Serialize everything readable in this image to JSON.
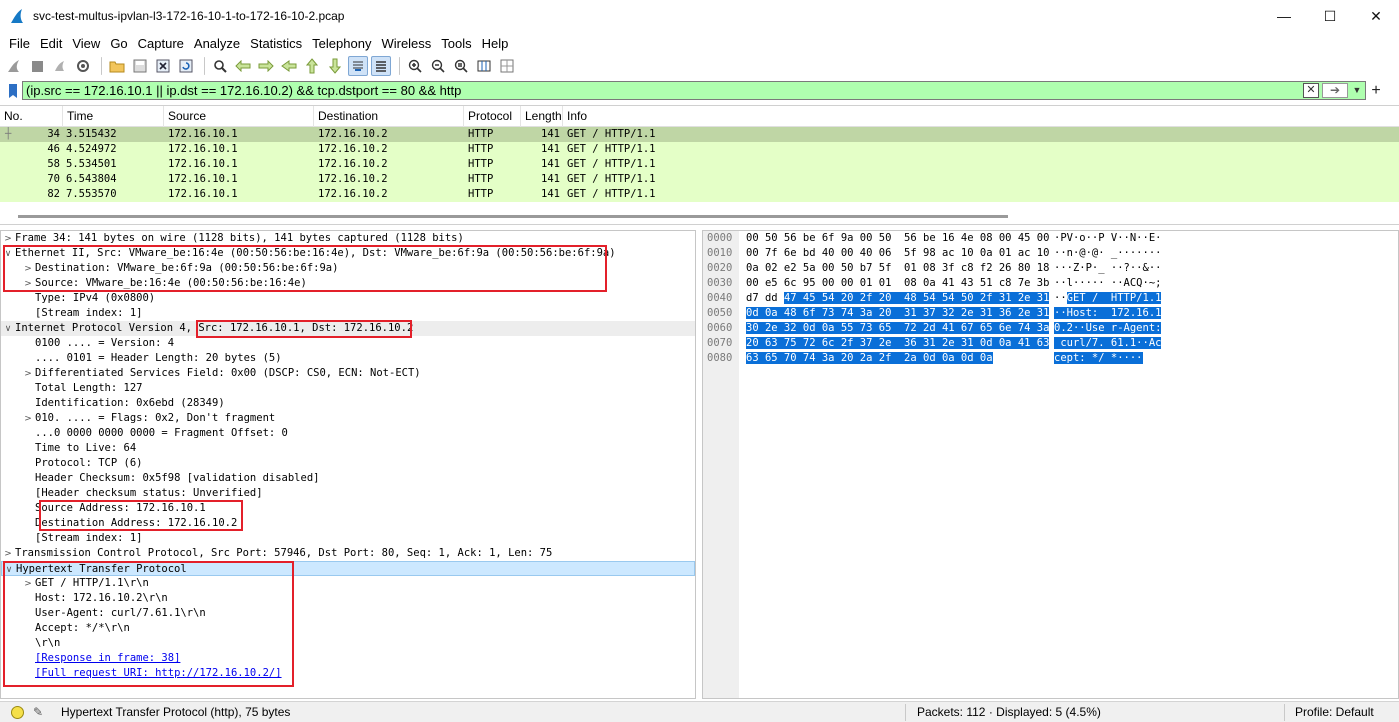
{
  "window": {
    "title": "svc-test-multus-ipvlan-l3-172-16-10-1-to-172-16-10-2.pcap",
    "minimize": "—",
    "maximize": "☐",
    "close": "✕"
  },
  "menu": [
    "File",
    "Edit",
    "View",
    "Go",
    "Capture",
    "Analyze",
    "Statistics",
    "Telephony",
    "Wireless",
    "Tools",
    "Help"
  ],
  "filter": {
    "value": "(ip.src == 172.16.10.1 || ip.dst == 172.16.10.2) && tcp.dstport == 80 && http",
    "bg_color": "#afffaf"
  },
  "packet_list": {
    "columns": [
      "No.",
      "Time",
      "Source",
      "Destination",
      "Protocol",
      "Length",
      "Info"
    ],
    "rows": [
      {
        "no": "34",
        "time": "3.515432",
        "src": "172.16.10.1",
        "dst": "172.16.10.2",
        "proto": "HTTP",
        "len": "141",
        "info": "GET / HTTP/1.1"
      },
      {
        "no": "46",
        "time": "4.524972",
        "src": "172.16.10.1",
        "dst": "172.16.10.2",
        "proto": "HTTP",
        "len": "141",
        "info": "GET / HTTP/1.1"
      },
      {
        "no": "58",
        "time": "5.534501",
        "src": "172.16.10.1",
        "dst": "172.16.10.2",
        "proto": "HTTP",
        "len": "141",
        "info": "GET / HTTP/1.1"
      },
      {
        "no": "70",
        "time": "6.543804",
        "src": "172.16.10.1",
        "dst": "172.16.10.2",
        "proto": "HTTP",
        "len": "141",
        "info": "GET / HTTP/1.1"
      },
      {
        "no": "82",
        "time": "7.553570",
        "src": "172.16.10.1",
        "dst": "172.16.10.2",
        "proto": "HTTP",
        "len": "141",
        "info": "GET / HTTP/1.1"
      }
    ],
    "row_color": "#e4ffc7",
    "selected_color": "#bfd6a5"
  },
  "details": {
    "frame": "Frame 34: 141 bytes on wire (1128 bits), 141 bytes captured (1128 bits)",
    "eth": "Ethernet II, Src: VMware_be:16:4e (00:50:56:be:16:4e), Dst: VMware_be:6f:9a (00:50:56:be:6f:9a)",
    "eth_dst": "Destination: VMware_be:6f:9a (00:50:56:be:6f:9a)",
    "eth_src": "Source: VMware_be:16:4e (00:50:56:be:16:4e)",
    "eth_type": "Type: IPv4 (0x0800)",
    "eth_stream": "[Stream index: 1]",
    "ip_prefix": "Internet Protocol Version 4,",
    "ip_addrs": "Src: 172.16.10.1, Dst: 172.16.10.2",
    "ip_version": "0100 .... = Version: 4",
    "ip_hlen": ".... 0101 = Header Length: 20 bytes (5)",
    "ip_dsf": "Differentiated Services Field: 0x00 (DSCP: CS0, ECN: Not-ECT)",
    "ip_totlen": "Total Length: 127",
    "ip_id": "Identification: 0x6ebd (28349)",
    "ip_flags": "010. .... = Flags: 0x2, Don't fragment",
    "ip_frag": "...0 0000 0000 0000 = Fragment Offset: 0",
    "ip_ttl": "Time to Live: 64",
    "ip_proto": "Protocol: TCP (6)",
    "ip_cksum": "Header Checksum: 0x5f98 [validation disabled]",
    "ip_cksum_status": "[Header checksum status: Unverified]",
    "ip_src": "Source Address: 172.16.10.1",
    "ip_dst": "Destination Address: 172.16.10.2",
    "ip_stream": "[Stream index: 1]",
    "tcp": "Transmission Control Protocol, Src Port: 57946, Dst Port: 80, Seq: 1, Ack: 1, Len: 75",
    "http": "Hypertext Transfer Protocol",
    "http_get": "GET / HTTP/1.1\\r\\n",
    "http_host": "Host: 172.16.10.2\\r\\n",
    "http_ua": "User-Agent: curl/7.61.1\\r\\n",
    "http_accept": "Accept: */*\\r\\n",
    "http_crlf": "\\r\\n",
    "http_response": "[Response in frame: 38]",
    "http_uri": "[Full request URI: http://172.16.10.2/]"
  },
  "bytes": [
    {
      "off": "0000",
      "hex": "00 50 56 be 6f 9a 00 50  56 be 16 4e 08 00 45 00",
      "asc": "·PV·o··P V··N··E·"
    },
    {
      "off": "0010",
      "hex": "00 7f 6e bd 40 00 40 06  5f 98 ac 10 0a 01 ac 10",
      "asc": "··n·@·@· _·······"
    },
    {
      "off": "0020",
      "hex": "0a 02 e2 5a 00 50 b7 5f  01 08 3f c8 f2 26 80 18",
      "asc": "···Z·P·_ ··?··&··"
    },
    {
      "off": "0030",
      "hex": "00 e5 6c 95 00 00 01 01  08 0a 41 43 51 c8 7e 3b",
      "asc": "··l····· ··ACQ·~;"
    },
    {
      "off": "0040",
      "hex_pre": "d7 dd ",
      "hex": "47 45 54 20 2f 20  48 54 54 50 2f 31 2e 31",
      "asc_pre": "··",
      "asc": "GET /  HTTP/1.1"
    },
    {
      "off": "0050",
      "hex": "0d 0a 48 6f 73 74 3a 20  31 37 32 2e 31 36 2e 31",
      "asc": "··Host:  172.16.1"
    },
    {
      "off": "0060",
      "hex": "30 2e 32 0d 0a 55 73 65  72 2d 41 67 65 6e 74 3a",
      "asc": "0.2··Use r-Agent:"
    },
    {
      "off": "0070",
      "hex": "20 63 75 72 6c 2f 37 2e  36 31 2e 31 0d 0a 41 63",
      "asc": " curl/7. 61.1··Ac"
    },
    {
      "off": "0080",
      "hex": "63 65 70 74 3a 20 2a 2f  2a 0d 0a 0d 0a",
      "asc": "cept: */ *····"
    }
  ],
  "status": {
    "field": "Hypertext Transfer Protocol (http), 75 bytes",
    "packets": "Packets: 112 · Displayed: 5 (4.5%)",
    "profile": "Profile: Default"
  }
}
